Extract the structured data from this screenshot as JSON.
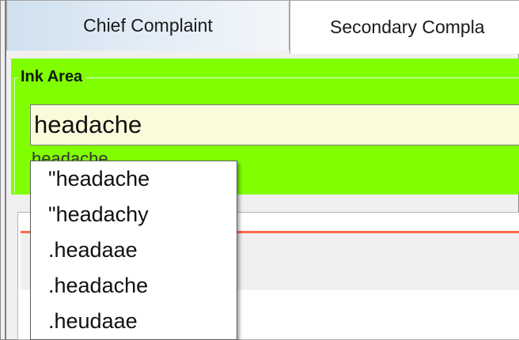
{
  "tabs": [
    {
      "label": "Chief Complaint",
      "selected": true
    },
    {
      "label": "Secondary Compla",
      "selected": false
    }
  ],
  "ink_area": {
    "title": "Ink Area",
    "value": "headache",
    "recognized_partial": "headache",
    "background_color": "#80ff00"
  },
  "suggestions": [
    "\"headache",
    "\"headachy",
    ".headaae",
    ".headache",
    ".heudaae"
  ],
  "accent_red": "#ff6a4a"
}
